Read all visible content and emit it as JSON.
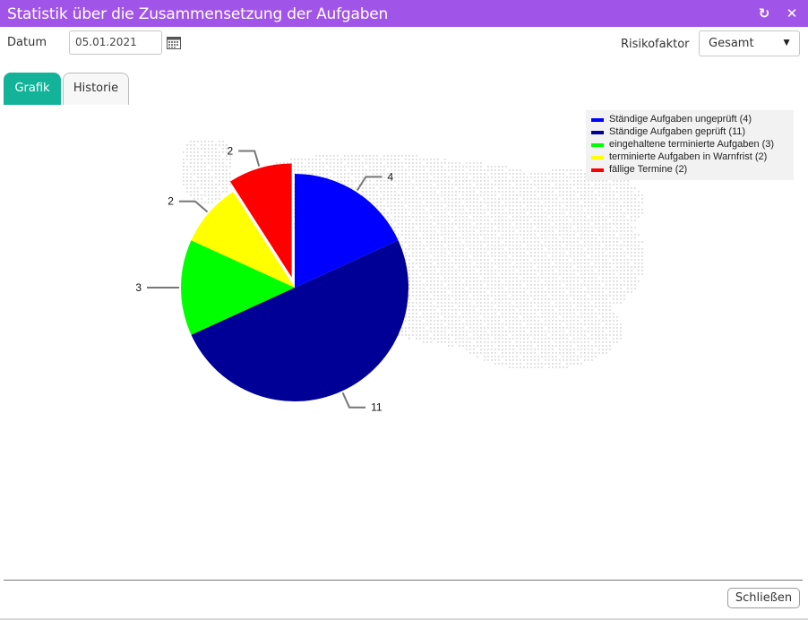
{
  "window": {
    "title": "Statistik über die Zusammensetzung der Aufgaben"
  },
  "toolbar": {
    "date_label": "Datum",
    "date_value": "05.01.2021",
    "risk_label": "Risikofaktor",
    "risk_value": "Gesamt"
  },
  "tabs": [
    {
      "label": "Grafik",
      "active": true
    },
    {
      "label": "Historie",
      "active": false
    }
  ],
  "colors": {
    "titlebar": "#a155e8",
    "active_tab": "#13b39a"
  },
  "chart_data": {
    "type": "pie",
    "slices": [
      {
        "label": "Ständige Aufgaben ungeprüft (4)",
        "value": 4,
        "color": "#0000ff",
        "data_label": "4"
      },
      {
        "label": "Ständige Aufgaben geprüft (11)",
        "value": 11,
        "color": "#000096",
        "data_label": "11"
      },
      {
        "label": "eingehaltene terminierte Aufgaben (3)",
        "value": 3,
        "color": "#00ff00",
        "data_label": "3"
      },
      {
        "label": "terminierte Aufgaben in Warnfrist (2)",
        "value": 2,
        "color": "#ffff00",
        "data_label": "2"
      },
      {
        "label": "fällige Termine (2)",
        "value": 2,
        "color": "#ff0000",
        "data_label": "2",
        "exploded": true
      }
    ],
    "legend": "top-right"
  },
  "footer": {
    "close_label": "Schließen"
  }
}
